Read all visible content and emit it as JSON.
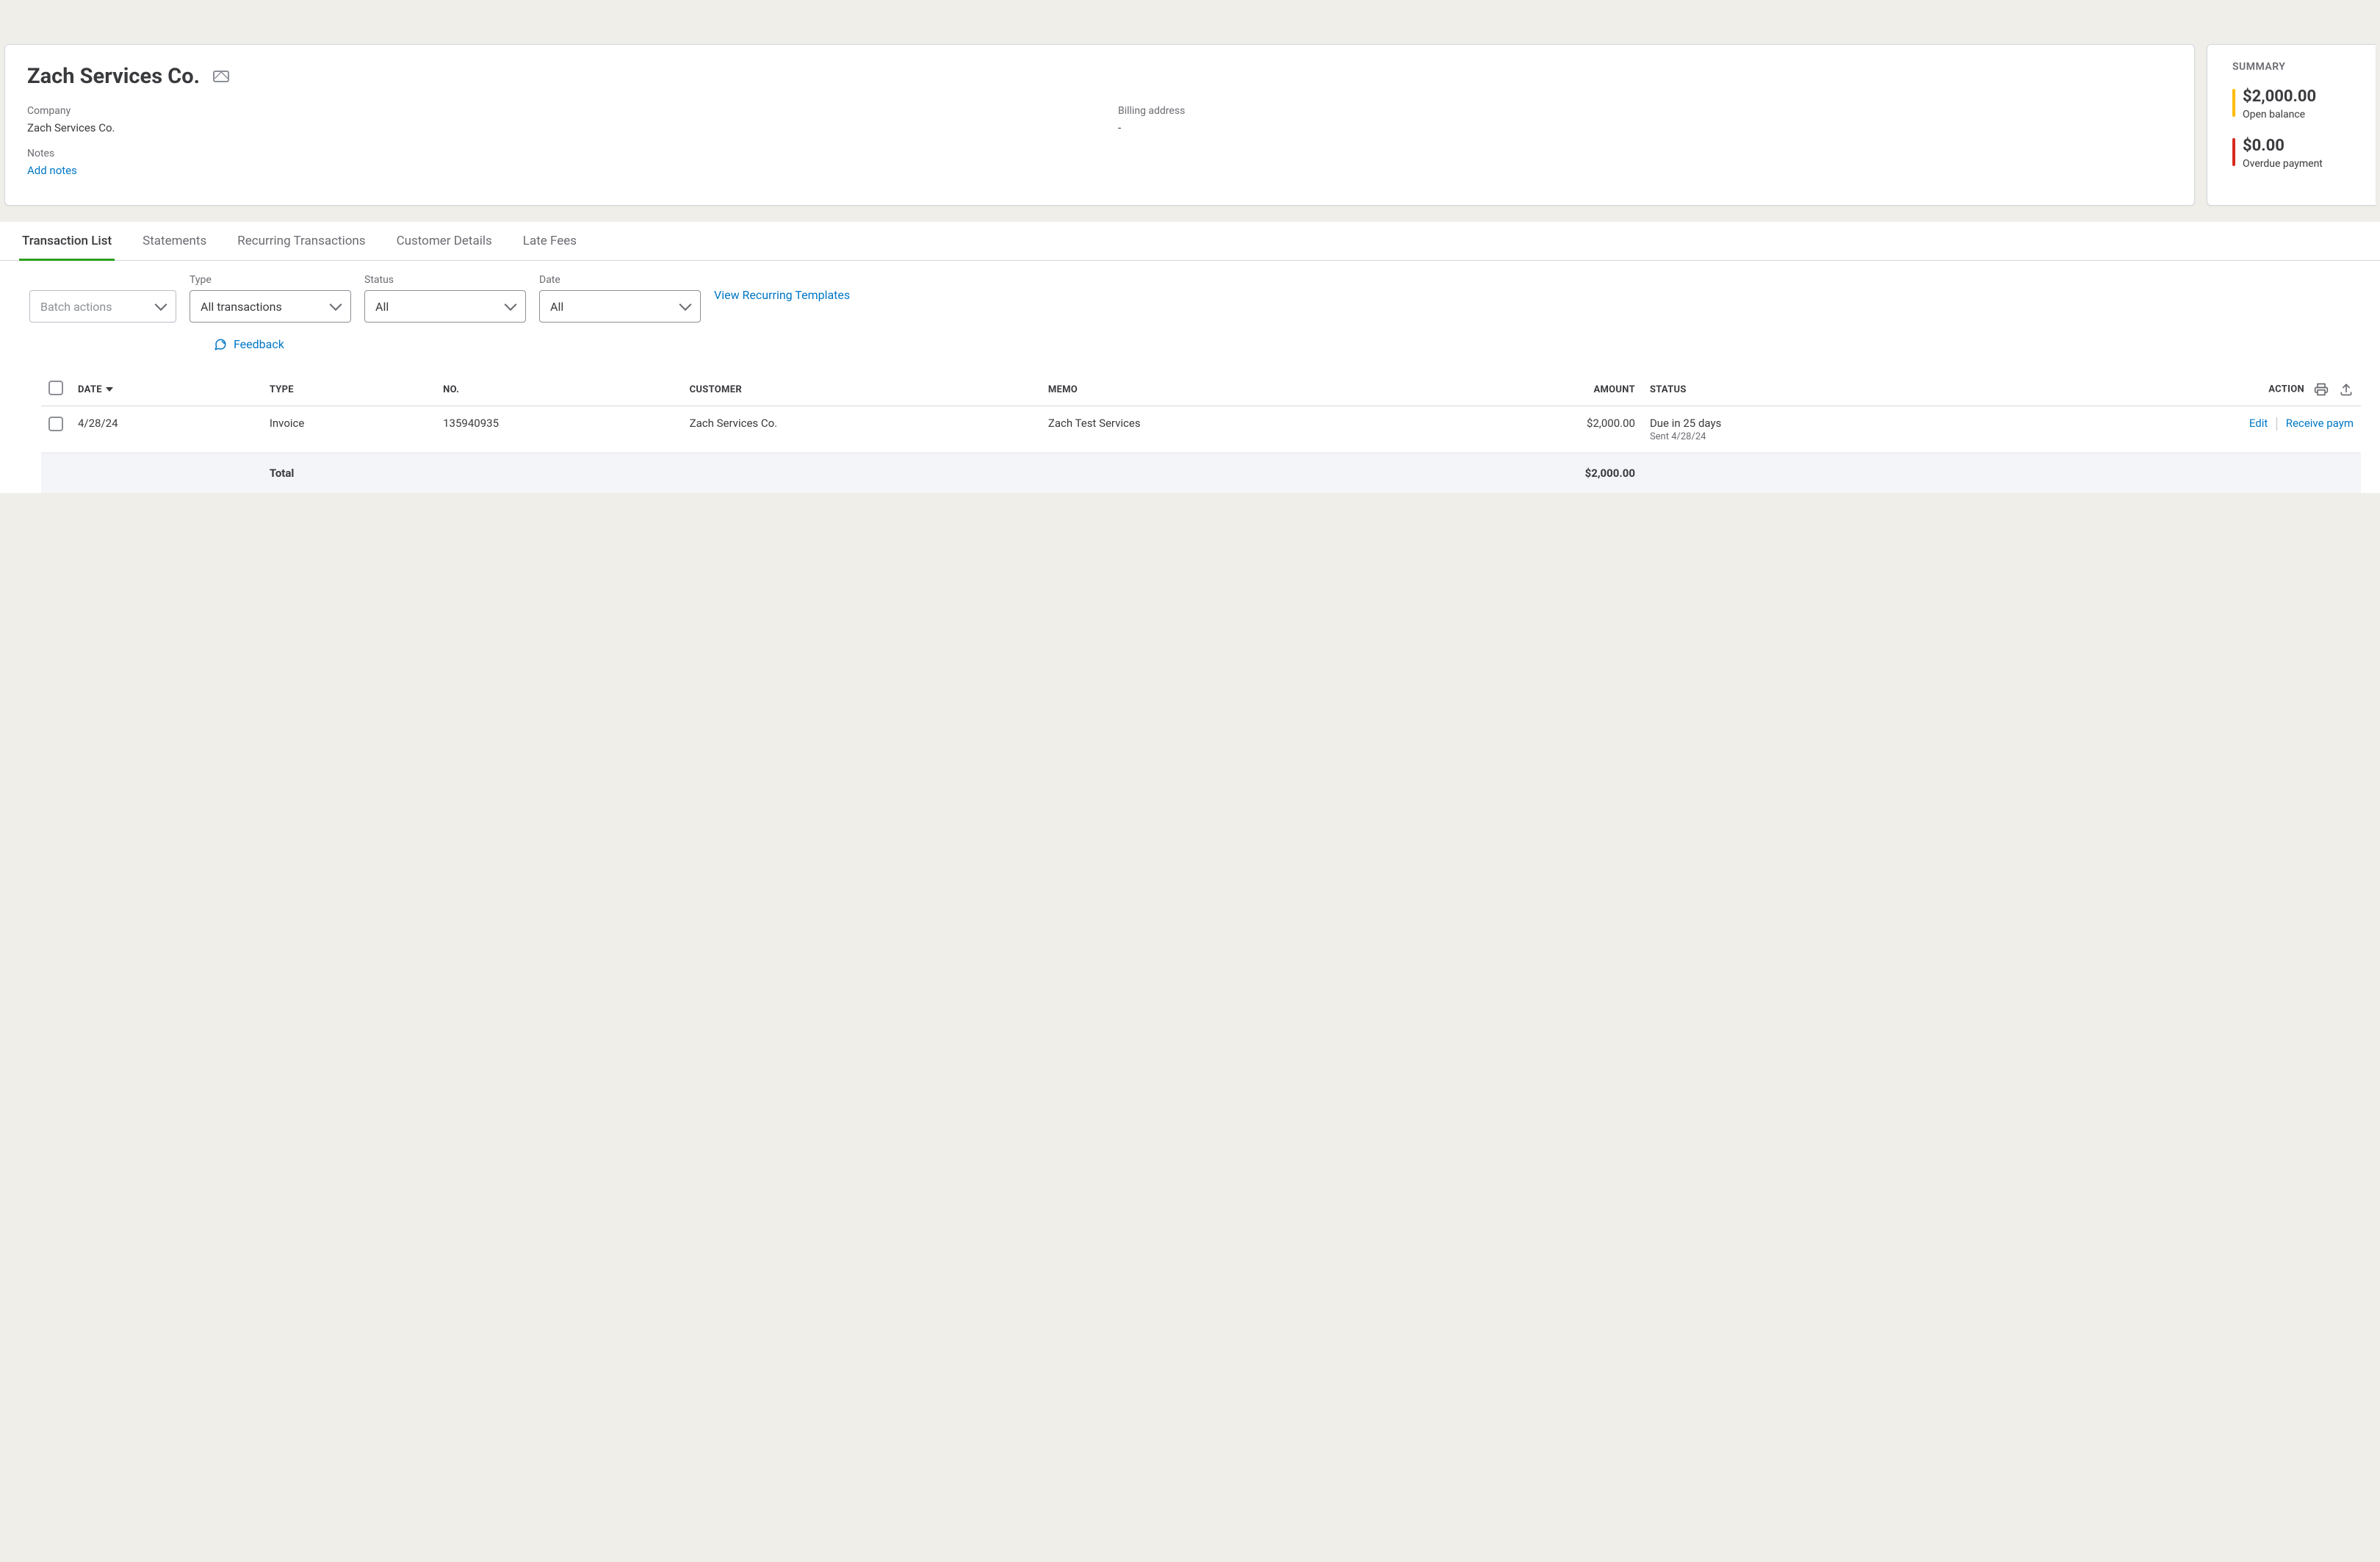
{
  "header": {
    "title": "Zach Services Co.",
    "company_label": "Company",
    "company_value": "Zach Services Co.",
    "billing_label": "Billing address",
    "billing_value": "-",
    "notes_label": "Notes",
    "add_notes": "Add notes"
  },
  "summary": {
    "title": "SUMMARY",
    "open_balance_amount": "$2,000.00",
    "open_balance_label": "Open balance",
    "overdue_amount": "$0.00",
    "overdue_label": "Overdue payment"
  },
  "tabs": [
    {
      "label": "Transaction List",
      "active": true
    },
    {
      "label": "Statements",
      "active": false
    },
    {
      "label": "Recurring Transactions",
      "active": false
    },
    {
      "label": "Customer Details",
      "active": false
    },
    {
      "label": "Late Fees",
      "active": false
    }
  ],
  "filters": {
    "batch_actions": "Batch actions",
    "type_label": "Type",
    "type_value": "All transactions",
    "status_label": "Status",
    "status_value": "All",
    "date_label": "Date",
    "date_value": "All",
    "recurring_link": "View Recurring Templates",
    "feedback": "Feedback"
  },
  "table": {
    "columns": {
      "date": "DATE",
      "type": "TYPE",
      "no": "NO.",
      "customer": "CUSTOMER",
      "memo": "MEMO",
      "amount": "AMOUNT",
      "status": "STATUS",
      "action": "ACTION"
    },
    "rows": [
      {
        "date": "4/28/24",
        "type": "Invoice",
        "no": "135940935",
        "customer": "Zach Services Co.",
        "memo": "Zach Test Services",
        "amount": "$2,000.00",
        "status": "Due in 25 days",
        "status_sub": "Sent 4/28/24",
        "action_edit": "Edit",
        "action_receive": "Receive paym"
      }
    ],
    "total_label": "Total",
    "total_amount": "$2,000.00"
  }
}
